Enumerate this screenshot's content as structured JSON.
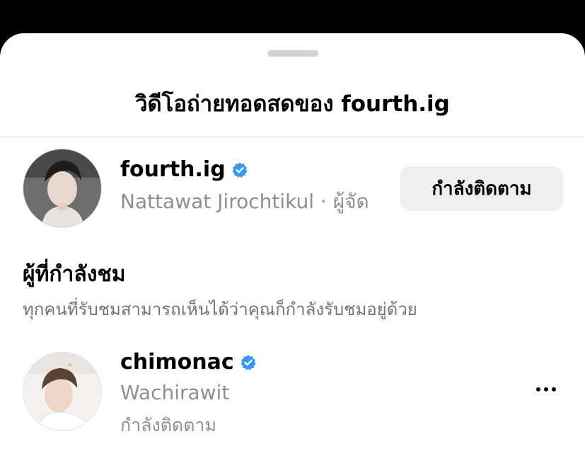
{
  "sheet": {
    "title": "วิดีโอถ่ายทอดสดของ fourth.ig"
  },
  "host": {
    "username": "fourth.ig",
    "verified": true,
    "subtitle": "Nattawat Jirochtikul · ผู้จัด",
    "follow_button_label": "กำลังติดตาม",
    "avatar_icon": "profile-photo-icon"
  },
  "viewers_section": {
    "title": "ผู้ที่กำลังชม",
    "description": "ทุกคนที่รับชมสามารถเห็นได้ว่าคุณก็กำลังรับชมอยู่ด้วย"
  },
  "viewers": [
    {
      "username": "chimonac",
      "verified": true,
      "full_name": "Wachirawit",
      "status": "กำลังติดตาม",
      "avatar_icon": "profile-photo-icon",
      "menu_icon": "more-horizontal-icon"
    }
  ],
  "colors": {
    "verified_badge": "#3897f0",
    "secondary_text": "#8e8e8e",
    "button_bg": "#efefef"
  }
}
